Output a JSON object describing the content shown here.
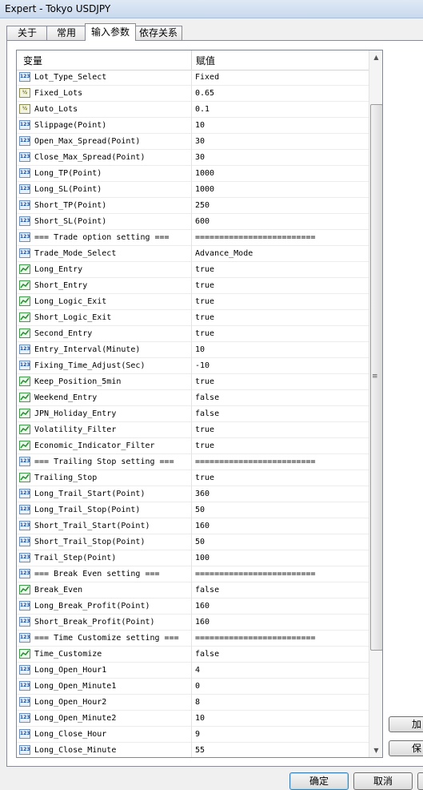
{
  "window": {
    "title": "Expert - Tokyo USDJPY"
  },
  "tabs": [
    "关于",
    "常用",
    "输入参数",
    "依存关系"
  ],
  "table": {
    "col_variable": "变量",
    "col_value": "赋值",
    "rows": [
      {
        "icon": "int",
        "name": "Lot_Type_Select",
        "value": "Fixed"
      },
      {
        "icon": "dbl",
        "name": "Fixed_Lots",
        "value": "0.65"
      },
      {
        "icon": "dbl",
        "name": "Auto_Lots",
        "value": "0.1"
      },
      {
        "icon": "int",
        "name": "Slippage(Point)",
        "value": "10"
      },
      {
        "icon": "int",
        "name": "Open_Max_Spread(Point)",
        "value": "30"
      },
      {
        "icon": "int",
        "name": "Close_Max_Spread(Point)",
        "value": "30"
      },
      {
        "icon": "int",
        "name": "Long_TP(Point)",
        "value": "1000"
      },
      {
        "icon": "int",
        "name": "Long_SL(Point)",
        "value": "1000"
      },
      {
        "icon": "int",
        "name": "Short_TP(Point)",
        "value": "250"
      },
      {
        "icon": "int",
        "name": "Short_SL(Point)",
        "value": "600"
      },
      {
        "icon": "int",
        "name": "=== Trade option setting ===",
        "value": "========================="
      },
      {
        "icon": "int",
        "name": "Trade_Mode_Select",
        "value": "Advance_Mode"
      },
      {
        "icon": "bool",
        "name": "Long_Entry",
        "value": "true"
      },
      {
        "icon": "bool",
        "name": "Short_Entry",
        "value": "true"
      },
      {
        "icon": "bool",
        "name": "Long_Logic_Exit",
        "value": "true"
      },
      {
        "icon": "bool",
        "name": "Short_Logic_Exit",
        "value": "true"
      },
      {
        "icon": "bool",
        "name": "Second_Entry",
        "value": "true"
      },
      {
        "icon": "int",
        "name": "Entry_Interval(Minute)",
        "value": "10"
      },
      {
        "icon": "int",
        "name": "Fixing_Time_Adjust(Sec)",
        "value": "-10"
      },
      {
        "icon": "bool",
        "name": "Keep_Position_5min",
        "value": "true"
      },
      {
        "icon": "bool",
        "name": "Weekend_Entry",
        "value": "false"
      },
      {
        "icon": "bool",
        "name": "JPN_Holiday_Entry",
        "value": "false"
      },
      {
        "icon": "bool",
        "name": "Volatility_Filter",
        "value": "true"
      },
      {
        "icon": "bool",
        "name": "Economic_Indicator_Filter",
        "value": "true"
      },
      {
        "icon": "int",
        "name": "=== Trailing Stop setting ===",
        "value": "========================="
      },
      {
        "icon": "bool",
        "name": "Trailing_Stop",
        "value": "true"
      },
      {
        "icon": "int",
        "name": "Long_Trail_Start(Point)",
        "value": "360"
      },
      {
        "icon": "int",
        "name": "Long_Trail_Stop(Point)",
        "value": "50"
      },
      {
        "icon": "int",
        "name": "Short_Trail_Start(Point)",
        "value": "160"
      },
      {
        "icon": "int",
        "name": "Short_Trail_Stop(Point)",
        "value": "50"
      },
      {
        "icon": "int",
        "name": "Trail_Step(Point)",
        "value": "100"
      },
      {
        "icon": "int",
        "name": "=== Break Even setting ===",
        "value": "========================="
      },
      {
        "icon": "bool",
        "name": "Break_Even",
        "value": "false"
      },
      {
        "icon": "int",
        "name": "Long_Break_Profit(Point)",
        "value": "160"
      },
      {
        "icon": "int",
        "name": "Short_Break_Profit(Point)",
        "value": "160"
      },
      {
        "icon": "int",
        "name": "=== Time Customize setting ===",
        "value": "========================="
      },
      {
        "icon": "bool",
        "name": "Time_Customize",
        "value": "false"
      },
      {
        "icon": "int",
        "name": "Long_Open_Hour1",
        "value": "4"
      },
      {
        "icon": "int",
        "name": "Long_Open_Minute1",
        "value": "0"
      },
      {
        "icon": "int",
        "name": "Long_Open_Hour2",
        "value": "8"
      },
      {
        "icon": "int",
        "name": "Long_Open_Minute2",
        "value": "10"
      },
      {
        "icon": "int",
        "name": "Long_Close_Hour",
        "value": "9"
      },
      {
        "icon": "int",
        "name": "Long_Close_Minute",
        "value": "55"
      }
    ]
  },
  "icon_glyphs": {
    "int": "123",
    "dbl": "½",
    "bool": ""
  },
  "buttons": {
    "load": "加",
    "save": "保",
    "ok": "确定",
    "cancel": "取消"
  }
}
